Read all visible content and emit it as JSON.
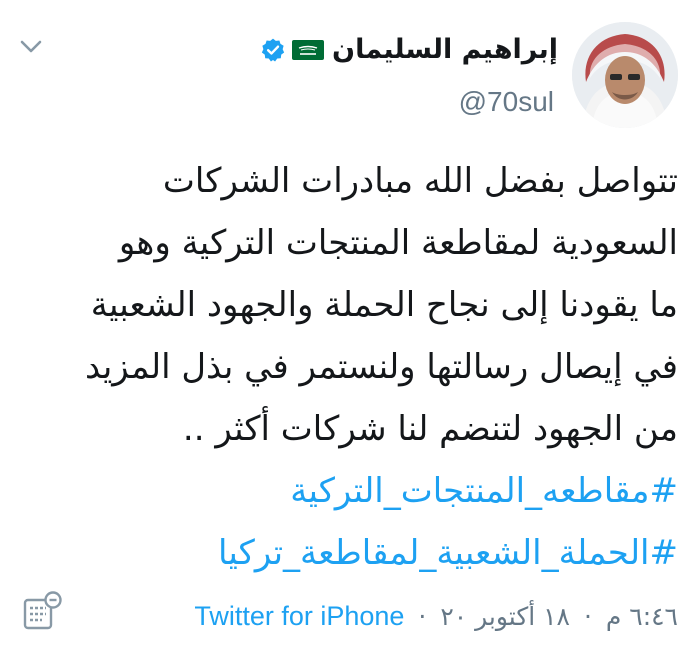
{
  "tweet": {
    "display_name": "إبراهيم السليمان",
    "handle": "@70sul",
    "text_lines": [
      "تتواصل بفضل الله مبادرات الشركات",
      "السعودية لمقاطعة المنتجات التركية وهو",
      "ما يقودنا إلى نجاح الحملة والجهود الشعبية",
      "في إيصال رسالتها ولنستمر في بذل المزيد",
      "من الجهود لتنضم لنا شركات أكثر .."
    ],
    "hashtags": [
      "#مقاطعه_المنتجات_التركية",
      "#الحملة_الشعبية_لمقاطعة_تركيا"
    ],
    "time": "٦:٤٦ م",
    "date": "١٨ أكتوبر ٢٠",
    "separator": "·",
    "source": "Twitter for iPhone"
  },
  "icons": {
    "verified": "verified-badge-icon",
    "flag": "saudi-flag-icon",
    "menu": "chevron-down-icon",
    "analytics": "analytics-icon"
  },
  "colors": {
    "link": "#1da1f2",
    "text": "#14171a",
    "muted": "#657786",
    "flag_green": "#006c35"
  }
}
